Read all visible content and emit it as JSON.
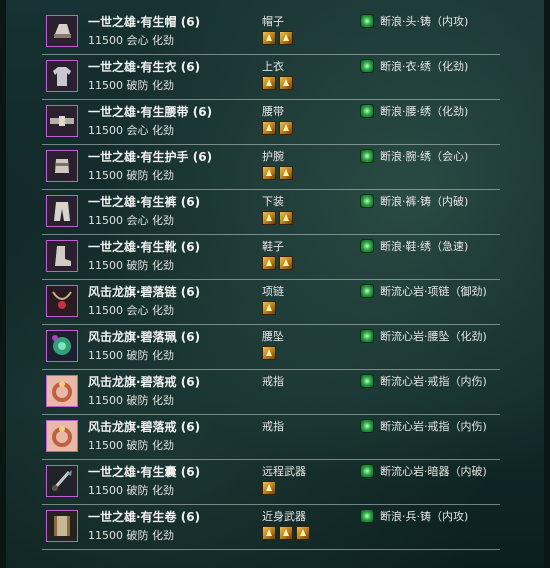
{
  "items": [
    {
      "icon": "hat-icon",
      "name": "一世之雄·有生帽 (6)",
      "stats": "11500 会心 化劲",
      "slot": "帽子",
      "gems": 2,
      "enchant": "断浪·头·铸（内攻)"
    },
    {
      "icon": "coat-icon",
      "name": "一世之雄·有生衣 (6)",
      "stats": "11500 破防 化劲",
      "slot": "上衣",
      "gems": 2,
      "enchant": "断浪·衣·绣（化劲)"
    },
    {
      "icon": "belt-icon",
      "name": "一世之雄·有生腰带 (6)",
      "stats": "11500 会心 化劲",
      "slot": "腰带",
      "gems": 2,
      "enchant": "断浪·腰·绣（化劲)"
    },
    {
      "icon": "bracer-icon",
      "name": "一世之雄·有生护手 (6)",
      "stats": "11500 破防 化劲",
      "slot": "护腕",
      "gems": 2,
      "enchant": "断浪·腕·绣（会心)"
    },
    {
      "icon": "pants-icon",
      "name": "一世之雄·有生裤 (6)",
      "stats": "11500 会心 化劲",
      "slot": "下装",
      "gems": 2,
      "enchant": "断浪·裤·铸（内破)"
    },
    {
      "icon": "boots-icon",
      "name": "一世之雄·有生靴 (6)",
      "stats": "11500 破防 化劲",
      "slot": "鞋子",
      "gems": 2,
      "enchant": "断浪·鞋·绣（急速)"
    },
    {
      "icon": "necklace-icon",
      "name": "风击龙旗·碧落链 (6)",
      "stats": "11500 会心 化劲",
      "slot": "项链",
      "gems": 1,
      "enchant": "断流心岩·项链（御劲)"
    },
    {
      "icon": "pendant-icon",
      "name": "风击龙旗·碧落珮 (6)",
      "stats": "11500 破防 化劲",
      "slot": "腰坠",
      "gems": 1,
      "enchant": "断流心岩·腰坠（化劲)"
    },
    {
      "icon": "ring-icon",
      "name": "风击龙旗·碧落戒 (6)",
      "stats": "11500 破防 化劲",
      "slot": "戒指",
      "gems": 0,
      "enchant": "断流心岩·戒指（内伤)"
    },
    {
      "icon": "ring-icon",
      "name": "风击龙旗·碧落戒 (6)",
      "stats": "11500 破防 化劲",
      "slot": "戒指",
      "gems": 0,
      "enchant": "断流心岩·戒指（内伤)"
    },
    {
      "icon": "ranged-weapon-icon",
      "name": "一世之雄·有生囊 (6)",
      "stats": "11500 破防 化劲",
      "slot": "远程武器",
      "gems": 1,
      "enchant": "断流心岩·暗器（内破)"
    },
    {
      "icon": "melee-weapon-icon",
      "name": "一世之雄·有生卷 (6)",
      "stats": "11500 破防 化劲",
      "slot": "近身武器",
      "gems": 3,
      "enchant": "断浪·兵·铸（内攻)"
    }
  ]
}
